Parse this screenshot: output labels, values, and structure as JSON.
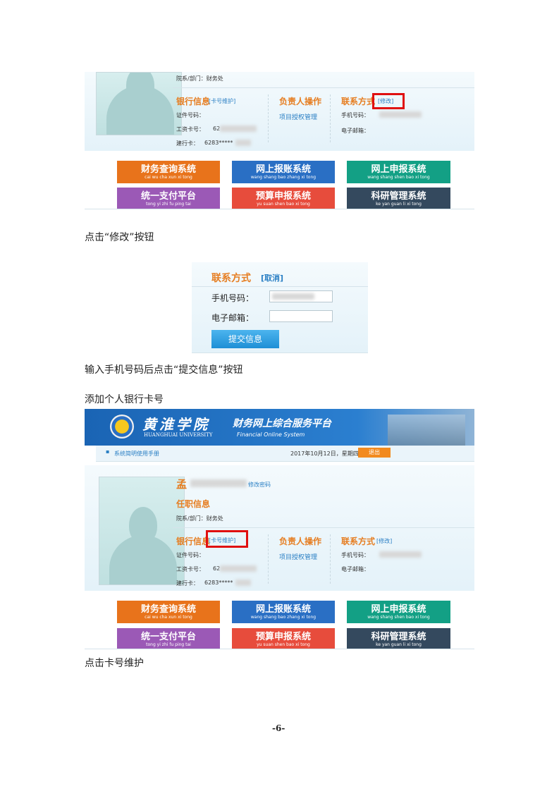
{
  "panel1": {
    "dept_line": "院系/部门：财务处",
    "bank_title": "银行信息",
    "card_maint": "[卡号维护]",
    "id_label": "证件号码：",
    "salary_label": "工资卡号：",
    "salary_prefix": "62",
    "ccb_label": "建行卡：",
    "ccb_value": "6283*****",
    "resp_title": "负责人操作",
    "proj_auth": "项目授权管理",
    "contact_title": "联系方式",
    "edit_link": "[修改]",
    "phone_label": "手机号码：",
    "email_label": "电子邮箱："
  },
  "systems": [
    {
      "cn": "财务查询系统",
      "py": "cai wu cha xun xi tong",
      "color": "#e8731b"
    },
    {
      "cn": "网上报账系统",
      "py": "wang shang bao zhang xi tong",
      "color": "#2a6fc4"
    },
    {
      "cn": "网上申报系统",
      "py": "wang shang shen bao xi tong",
      "color": "#13a085"
    },
    {
      "cn": "统一支付平台",
      "py": "tong yi zhi fu ping tai",
      "color": "#9b59b6"
    },
    {
      "cn": "预算申报系统",
      "py": "yu suan shen bao xi tong",
      "color": "#e74c3c"
    },
    {
      "cn": "科研管理系统",
      "py": "ke yan guan li xi tong",
      "color": "#34495e"
    }
  ],
  "step1_text": "点击“修改”按钮",
  "contact_form": {
    "title": "联系方式",
    "cancel": "[取消]",
    "phone_label": "手机号码：",
    "email_label": "电子邮箱：",
    "submit": "提交信息"
  },
  "step2_text": "输入手机号码后点击“提交信息”按钮",
  "section_heading": "添加个人银行卡号",
  "portal": {
    "univ_cn": "黄淮学院",
    "univ_en": "HUANGHUAI UNIVERSITY",
    "platform_title": "财务网上综合服务平台",
    "platform_en": "Financial  Online  System",
    "manual_link": "系统简明使用手册",
    "date": "2017年10月12日，星期四",
    "logout": "退出",
    "name_char": "孟",
    "change_pwd": "修改密码",
    "job_title": "任职信息",
    "dept_line": "院系/部门：财务处"
  },
  "panel2": {
    "bank_title": "银行信息",
    "card_maint": "[卡号维护]",
    "id_label": "证件号码：",
    "salary_label": "工资卡号：",
    "salary_prefix": "62",
    "ccb_label": "建行卡：",
    "ccb_value": "6283*****",
    "resp_title": "负责人操作",
    "proj_auth": "项目授权管理",
    "contact_title": "联系方式",
    "edit_link": "[修改]",
    "phone_label": "手机号码：",
    "email_label": "电子邮箱："
  },
  "step3_text": "点击卡号维护",
  "page_number": "-6-"
}
